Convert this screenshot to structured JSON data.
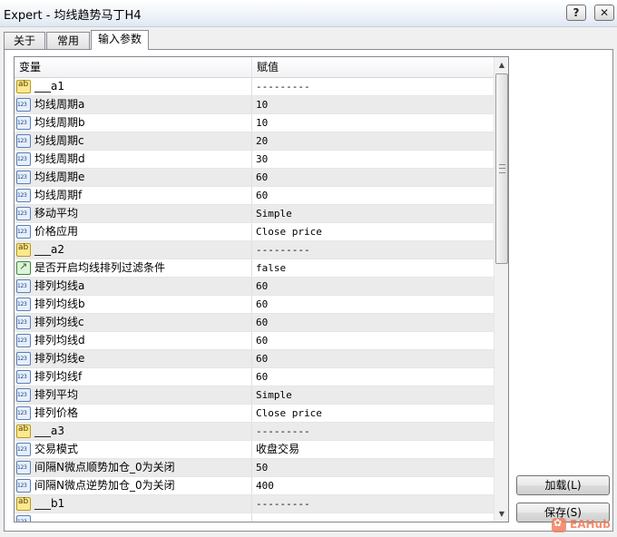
{
  "window": {
    "title": "Expert - 均线趋势马丁H4",
    "help_label": "?",
    "close_label": "✕"
  },
  "tabs": [
    {
      "label": "关于",
      "active": false
    },
    {
      "label": "常用",
      "active": false
    },
    {
      "label": "输入参数",
      "active": true
    }
  ],
  "table": {
    "col_variable": "变量",
    "col_value": "赋值",
    "rows": [
      {
        "icon": "ab",
        "name": "___a1",
        "value": "---------"
      },
      {
        "icon": "123",
        "name": "均线周期a",
        "value": "10"
      },
      {
        "icon": "123",
        "name": "均线周期b",
        "value": "10"
      },
      {
        "icon": "123",
        "name": "均线周期c",
        "value": "20"
      },
      {
        "icon": "123",
        "name": "均线周期d",
        "value": "30"
      },
      {
        "icon": "123",
        "name": "均线周期e",
        "value": "60"
      },
      {
        "icon": "123",
        "name": "均线周期f",
        "value": "60"
      },
      {
        "icon": "123",
        "name": "移动平均",
        "value": "Simple"
      },
      {
        "icon": "123",
        "name": "价格应用",
        "value": "Close price"
      },
      {
        "icon": "ab",
        "name": "___a2",
        "value": "---------"
      },
      {
        "icon": "bool",
        "name": "是否开启均线排列过滤条件",
        "value": "false"
      },
      {
        "icon": "123",
        "name": "排列均线a",
        "value": "60"
      },
      {
        "icon": "123",
        "name": "排列均线b",
        "value": "60"
      },
      {
        "icon": "123",
        "name": "排列均线c",
        "value": "60"
      },
      {
        "icon": "123",
        "name": "排列均线d",
        "value": "60"
      },
      {
        "icon": "123",
        "name": "排列均线e",
        "value": "60"
      },
      {
        "icon": "123",
        "name": "排列均线f",
        "value": "60"
      },
      {
        "icon": "123",
        "name": "排列平均",
        "value": "Simple"
      },
      {
        "icon": "123",
        "name": "排列价格",
        "value": "Close price"
      },
      {
        "icon": "ab",
        "name": "___a3",
        "value": "---------"
      },
      {
        "icon": "123",
        "name": "交易模式",
        "value": "收盘交易"
      },
      {
        "icon": "123",
        "name": "间隔N微点顺势加仓_0为关闭",
        "value": "50"
      },
      {
        "icon": "123",
        "name": "间隔N微点逆势加仓_0为关闭",
        "value": "400"
      },
      {
        "icon": "ab",
        "name": "___b1",
        "value": "---------"
      },
      {
        "icon": "123",
        "name": "",
        "value": ""
      }
    ]
  },
  "buttons": {
    "load": "加载(L)",
    "save": "保存(S)"
  },
  "watermark": {
    "text": "EAHub"
  }
}
